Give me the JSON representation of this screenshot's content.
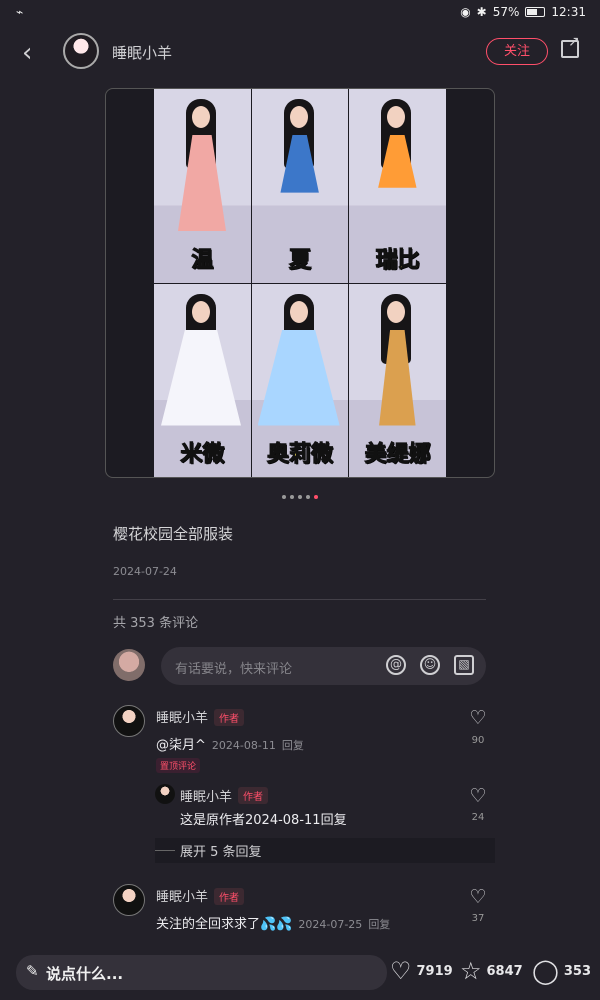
{
  "status_bar": {
    "battery": "57%",
    "time": "12:31"
  },
  "header": {
    "author": "睡眠小羊",
    "follow": "关注"
  },
  "post": {
    "image_labels": [
      "温",
      "夏",
      "瑞比",
      "米微",
      "奥莉微",
      "美缇娜"
    ],
    "title": "樱花校园全部服装",
    "date": "2024-07-24",
    "carousel": {
      "count": 5,
      "active_index": 4
    }
  },
  "comments_section": {
    "count_text": "共 353 条评论",
    "input_placeholder": "有话要说，快来评论",
    "author_badge": "作者",
    "reply_label": "回复",
    "pinned_label": "置顶评论",
    "expand_text": "展开 5 条回复"
  },
  "comments": [
    {
      "name": "睡眠小羊",
      "text": "@柒月^",
      "date": "2024-08-11",
      "likes": "90"
    },
    {
      "name": "睡眠小羊",
      "text": "这是原作者",
      "date": "2024-08-11",
      "likes": "24"
    },
    {
      "name": "睡眠小羊",
      "text": "关注的全回求求了💦💦",
      "date": "2024-07-25",
      "likes": "37"
    }
  ],
  "bottom_bar": {
    "say": "说点什么...",
    "likes": "7919",
    "stars": "6847",
    "comments": "353"
  },
  "icons": {
    "back": "chevron-left-icon",
    "share": "share-icon",
    "heart": "heart-icon",
    "star": "star-icon",
    "comment": "chat-bubble-icon"
  }
}
